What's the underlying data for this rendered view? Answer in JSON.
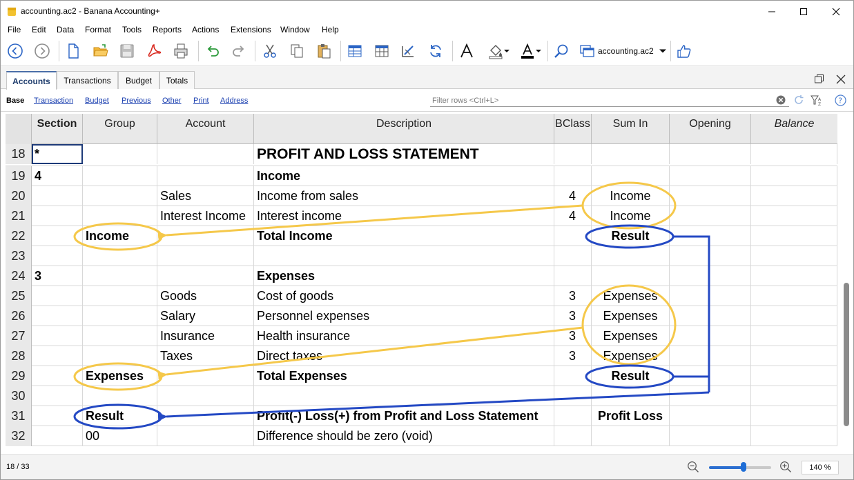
{
  "window": {
    "title": "accounting.ac2 - Banana Accounting+"
  },
  "menu": [
    "File",
    "Edit",
    "Data",
    "Format",
    "Tools",
    "Reports",
    "Actions",
    "Extensions",
    "Window",
    "Help"
  ],
  "toolbar": {
    "file_name": "accounting.ac2"
  },
  "tabs": [
    {
      "label": "Accounts",
      "active": true
    },
    {
      "label": "Transactions",
      "active": false
    },
    {
      "label": "Budget",
      "active": false
    },
    {
      "label": "Totals",
      "active": false
    }
  ],
  "views": {
    "base": "Base",
    "links": [
      "Transaction",
      "Budget",
      "Previous",
      "Other",
      "Print",
      "Address"
    ]
  },
  "filter": {
    "placeholder": "Filter rows <Ctrl+L>"
  },
  "columns": [
    "Section",
    "Group",
    "Account",
    "Description",
    "BClass",
    "Sum In",
    "Opening",
    "Balance"
  ],
  "rows": [
    {
      "num": "18",
      "section": "*",
      "group": "",
      "account": "",
      "description": "PROFIT AND LOSS STATEMENT",
      "bclass": "",
      "sumin": "",
      "opening": "",
      "balance": ""
    },
    {
      "num": "19",
      "section": "4",
      "group": "",
      "account": "",
      "description": "Income",
      "bclass": "",
      "sumin": "",
      "opening": "",
      "balance": ""
    },
    {
      "num": "20",
      "section": "",
      "group": "",
      "account": "Sales",
      "description": "Income from sales",
      "bclass": "4",
      "sumin": "Income",
      "opening": "",
      "balance": ""
    },
    {
      "num": "21",
      "section": "",
      "group": "",
      "account": "Interest Income",
      "description": "Interest income",
      "bclass": "4",
      "sumin": "Income",
      "opening": "",
      "balance": ""
    },
    {
      "num": "22",
      "section": "",
      "group": "Income",
      "account": "",
      "description": "Total Income",
      "bclass": "",
      "sumin": "Result",
      "opening": "",
      "balance": ""
    },
    {
      "num": "23",
      "section": "",
      "group": "",
      "account": "",
      "description": "",
      "bclass": "",
      "sumin": "",
      "opening": "",
      "balance": ""
    },
    {
      "num": "24",
      "section": "3",
      "group": "",
      "account": "",
      "description": "Expenses",
      "bclass": "",
      "sumin": "",
      "opening": "",
      "balance": ""
    },
    {
      "num": "25",
      "section": "",
      "group": "",
      "account": "Goods",
      "description": "Cost of goods",
      "bclass": "3",
      "sumin": "Expenses",
      "opening": "",
      "balance": ""
    },
    {
      "num": "26",
      "section": "",
      "group": "",
      "account": "Salary",
      "description": "Personnel expenses",
      "bclass": "3",
      "sumin": "Expenses",
      "opening": "",
      "balance": ""
    },
    {
      "num": "27",
      "section": "",
      "group": "",
      "account": "Insurance",
      "description": "Health insurance",
      "bclass": "3",
      "sumin": "Expenses",
      "opening": "",
      "balance": ""
    },
    {
      "num": "28",
      "section": "",
      "group": "",
      "account": "Taxes",
      "description": "Direct taxes",
      "bclass": "3",
      "sumin": "Expenses",
      "opening": "",
      "balance": ""
    },
    {
      "num": "29",
      "section": "",
      "group": "Expenses",
      "account": "",
      "description": "Total Expenses",
      "bclass": "",
      "sumin": "Result",
      "opening": "",
      "balance": ""
    },
    {
      "num": "30",
      "section": "",
      "group": "",
      "account": "",
      "description": "",
      "bclass": "",
      "sumin": "",
      "opening": "",
      "balance": ""
    },
    {
      "num": "31",
      "section": "",
      "group": "Result",
      "account": "",
      "description": "Profit(-) Loss(+) from Profit and Loss Statement",
      "bclass": "",
      "sumin": "Profit Loss",
      "opening": "",
      "balance": ""
    },
    {
      "num": "32",
      "section": "",
      "group": "00",
      "account": "",
      "description": "Difference should be zero (void)",
      "bclass": "",
      "sumin": "",
      "opening": "",
      "balance": ""
    }
  ],
  "status": {
    "position": "18 / 33",
    "zoom": "140 %",
    "zoom_fraction": 0.55
  },
  "colors": {
    "yellow_annotation": "#f5c84a",
    "blue_annotation": "#2449c4",
    "tab_accent": "#4a6ea8",
    "link": "#1a3fb0"
  }
}
